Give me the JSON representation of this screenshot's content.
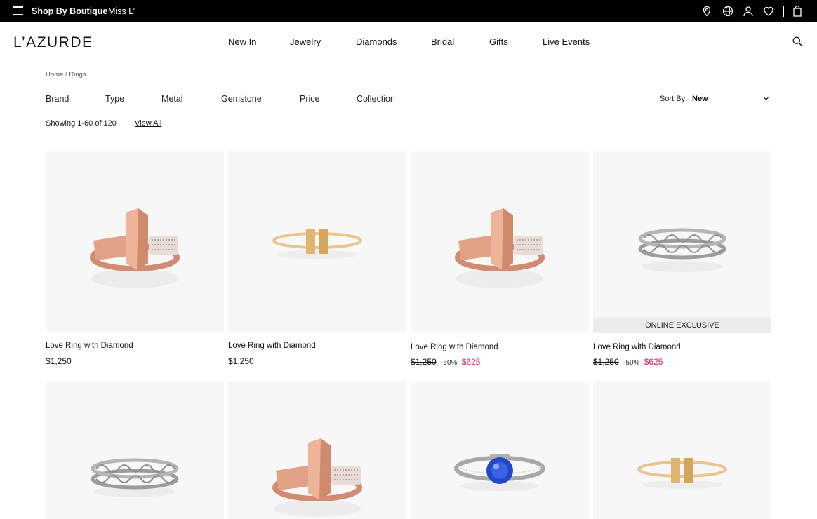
{
  "topbar": {
    "boutique_label": "Shop By Boutique",
    "miss_label": "Miss L’",
    "icons": [
      "menu-icon",
      "location-icon",
      "globe-icon",
      "user-icon",
      "heart-icon",
      "shopping-bag-icon"
    ]
  },
  "header": {
    "logo": "L’AZURDE",
    "nav": [
      "New In",
      "Jewelry",
      "Diamonds",
      "Bridal",
      "Gifts",
      "Live Events"
    ]
  },
  "breadcrumb": {
    "home": "Home",
    "separator": "/",
    "current": "Rings"
  },
  "filters": {
    "items": [
      "Brand",
      "Type",
      "Metal",
      "Gemstone",
      "Price",
      "Collection"
    ],
    "sort_label": "Sort By:",
    "sort_value": "New"
  },
  "results": {
    "showing": "Showing 1-60 of 120",
    "view_all": "View All"
  },
  "colors": {
    "sale": "#d6246e",
    "topbar": "#000000",
    "image_bg": "#f7f7f7"
  },
  "products": [
    {
      "name": "Love Ring with Diamond",
      "price": "$1,250",
      "type": "rose-t-diamond"
    },
    {
      "name": "Love Ring with Diamond",
      "price": "$1,250",
      "type": "gold-t"
    },
    {
      "name": "Love Ring with Diamond",
      "old_price": "$1,250",
      "discount": "-50%",
      "sale_price": "$625",
      "type": "rose-t-diamond"
    },
    {
      "name": "Love Ring with Diamond",
      "old_price": "$1,250",
      "discount": "-50%",
      "sale_price": "$625",
      "badge": "ONLINE EXCLUSIVE",
      "type": "silver-vine"
    },
    {
      "type": "silver-vine"
    },
    {
      "type": "rose-t-diamond"
    },
    {
      "type": "sapphire-solitaire"
    },
    {
      "type": "gold-t"
    }
  ]
}
